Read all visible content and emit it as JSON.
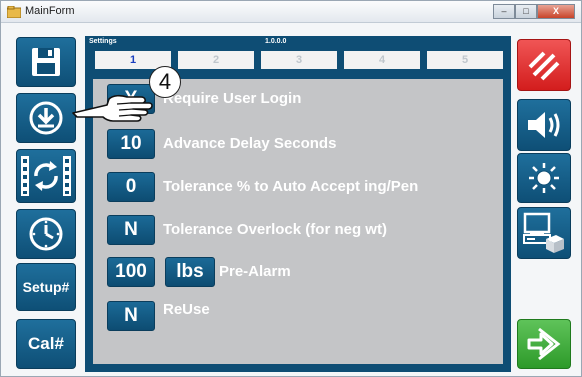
{
  "window": {
    "title": "MainForm",
    "controls": {
      "minimize": "–",
      "maximize": "□",
      "close": "X"
    }
  },
  "left_nav": {
    "items": [
      {
        "icon": "save-icon"
      },
      {
        "icon": "download-icon"
      },
      {
        "icon": "sync-icon"
      },
      {
        "icon": "clock-icon"
      },
      {
        "label": "Setup#"
      },
      {
        "label": "Cal#"
      }
    ]
  },
  "settings_panel": {
    "title": "Settings",
    "version": "1.0.0.0",
    "tabs": [
      "1",
      "2",
      "3",
      "4",
      "5"
    ],
    "active_tab": "1",
    "rows": [
      {
        "value": "Y",
        "label": "Require User Login"
      },
      {
        "value": "10",
        "label": "Advance Delay Seconds"
      },
      {
        "value": "0",
        "label": "Tolerance % to Auto Accept ing/Pen"
      },
      {
        "value": "N",
        "label": "Tolerance Overlock (for neg wt)"
      },
      {
        "value": "100",
        "unit": "lbs",
        "label": "Pre-Alarm"
      },
      {
        "value": "N",
        "label": "ReUse"
      }
    ]
  },
  "annotation": {
    "callout_number": "4"
  },
  "right_nav": {
    "items": [
      {
        "icon": "stop-icon",
        "color": "#e52a2a"
      },
      {
        "icon": "speaker-icon",
        "color": "#125d88"
      },
      {
        "icon": "brightness-icon",
        "color": "#125d88"
      },
      {
        "icon": "computer-printer-icon",
        "color": "#125d88"
      },
      {
        "icon": "exit-icon",
        "color": "#3caa36"
      }
    ]
  },
  "colors": {
    "accent_blue": "#125d88",
    "panel_dark": "#0e4d74",
    "content_gray": "#c4c5c7",
    "alert_red": "#e52a2a",
    "go_green": "#3caa36",
    "active_tab_text": "#1a3fbf"
  }
}
